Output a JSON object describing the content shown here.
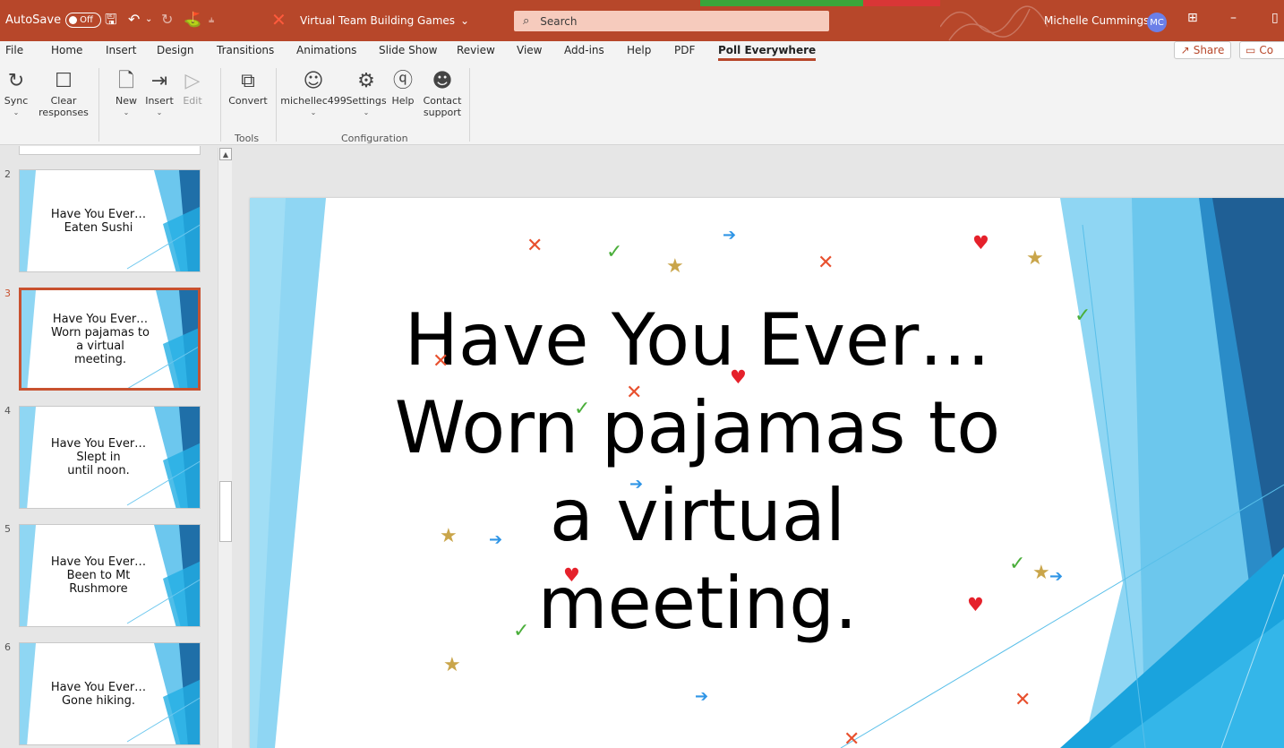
{
  "titlebar": {
    "autosave_label": "AutoSave",
    "autosave_state": "Off",
    "document_title": "Virtual Team Building Games",
    "title_caret": "⌄",
    "search_placeholder": "Search",
    "user_name": "Michelle Cummings",
    "user_initials": "MC",
    "accent_color": "#b7472a"
  },
  "tabs": [
    "File",
    "Home",
    "Insert",
    "Design",
    "Transitions",
    "Animations",
    "Slide Show",
    "Review",
    "View",
    "Add-ins",
    "Help",
    "PDF",
    "Poll Everywhere"
  ],
  "active_tab": "Poll Everywhere",
  "share_label": "Share",
  "comments_label": "Co",
  "ribbon": {
    "sync": "Sync",
    "clear_1": "Clear",
    "clear_2": "responses",
    "new": "New",
    "insert": "Insert",
    "edit": "Edit",
    "convert": "Convert",
    "account": "michellec499",
    "settings": "Settings",
    "help": "Help",
    "contact_1": "Contact",
    "contact_2": "support",
    "group_tools": "Tools",
    "group_configuration": "Configuration"
  },
  "thumbnails": [
    {
      "number": "2",
      "text": "Have You Ever…\nEaten Sushi"
    },
    {
      "number": "3",
      "text": "Have You Ever…\nWorn pajamas to\na virtual\nmeeting."
    },
    {
      "number": "4",
      "text": "Have You Ever…\nSlept in\nuntil noon."
    },
    {
      "number": "5",
      "text": "Have You Ever…\nBeen to Mt\nRushmore"
    },
    {
      "number": "6",
      "text": "Have You Ever…\nGone hiking."
    }
  ],
  "selected_slide_number": "3",
  "slide": {
    "title_lines": [
      "Have You Ever…",
      "Worn pajamas to",
      "a virtual",
      "meeting."
    ],
    "marker_colors": {
      "x": "#e8502e",
      "check": "#4aae3a",
      "star": "#c9a54a",
      "heart": "#e5212b",
      "arrow": "#2f95e6"
    }
  }
}
